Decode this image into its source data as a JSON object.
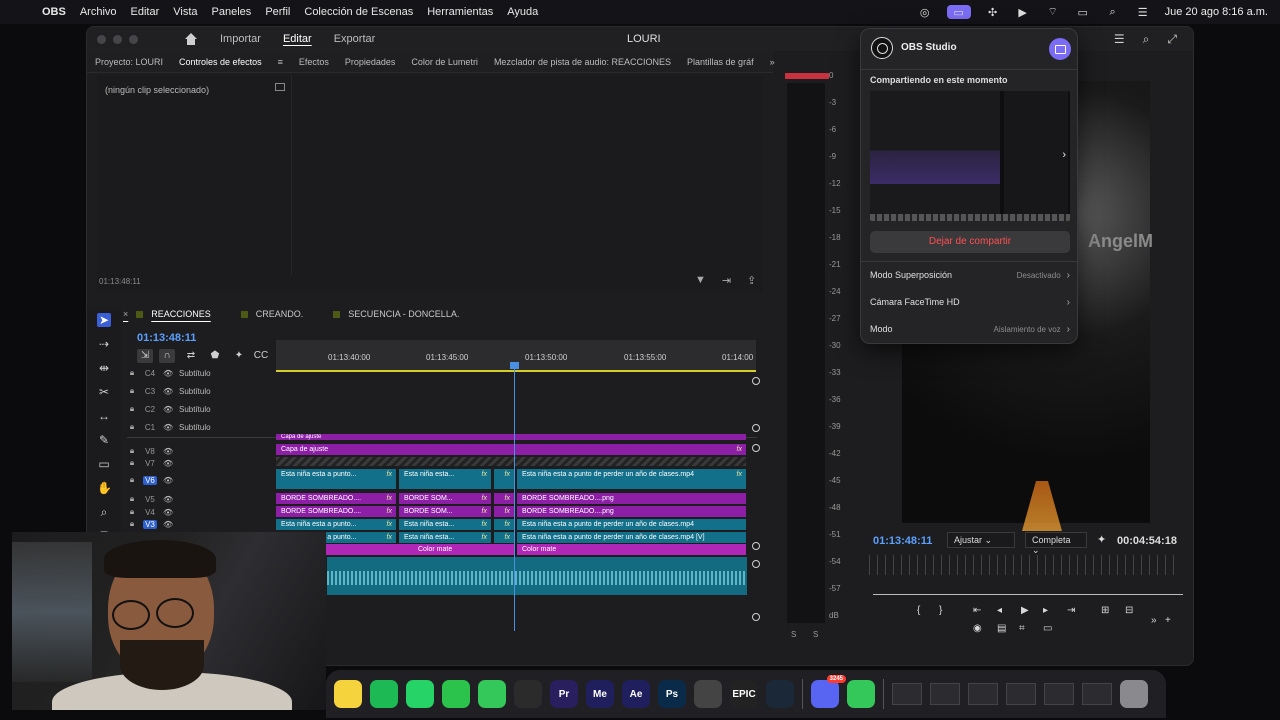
{
  "menubar": {
    "app": "OBS",
    "menus": [
      "Archivo",
      "Editar",
      "Vista",
      "Paneles",
      "Perfil",
      "Colección de Escenas",
      "Herramientas",
      "Ayuda"
    ],
    "clock": "Jue 20 ago 8:16 a.m."
  },
  "premiere": {
    "workspace_tabs": [
      "Importar",
      "Editar",
      "Exportar"
    ],
    "active_workspace": "Editar",
    "project_name": "LOURI",
    "panel_tabs": [
      "Proyecto: LOURI",
      "Controles de efectos",
      "Efectos",
      "Propiedades",
      "Color de Lumetri",
      "Mezclador de pista de audio: REACCIONES",
      "Plantillas de gráf"
    ],
    "effect_controls": {
      "no_clip": "(ningún clip seleccionado)",
      "time": "01:13:48:11"
    },
    "meter_labels": [
      "0",
      "-3",
      "-6",
      "-9",
      "-12",
      "-15",
      "-18",
      "-21",
      "-24",
      "-27",
      "-30",
      "-33",
      "-36",
      "-39",
      "-42",
      "-45",
      "-48",
      "-51",
      "-54",
      "-57",
      "dB"
    ],
    "meter_footer": [
      "S",
      "S"
    ],
    "sequence_tabs": [
      "REACCIONES",
      "CREANDO.",
      "SECUENCIA - DONCELLA."
    ],
    "timeline": {
      "timecode": "01:13:48:11",
      "ruler_labels": [
        "01:13:40:00",
        "01:13:45:00",
        "01:13:50:00",
        "01:13:55:00",
        "01:14:00"
      ],
      "caption_tracks": [
        {
          "name": "C4",
          "label": "Subtítulo"
        },
        {
          "name": "C3",
          "label": "Subtítulo"
        },
        {
          "name": "C2",
          "label": "Subtítulo"
        },
        {
          "name": "C1",
          "label": "Subtítulo"
        }
      ],
      "video_tracks": [
        "V8",
        "V7",
        "V6",
        "V5",
        "V4",
        "V3"
      ],
      "clips": {
        "capa_top": "Capa de ajuste",
        "capa": "Capa de ajuste",
        "v6_a": "Esta niña esta a punto...",
        "v6_b": "Esta niña esta...",
        "v6_c": "Esta niña esta a punto de perder un año de clases.mp4",
        "v5_a": "BORDE SOMBREADO....",
        "v5_b": "BORDE SOM...",
        "v5_c": "BORDE SOMBREADO....png",
        "v4_a": "BORDE SOMBREADO....",
        "v4_b": "BORDE SOM...",
        "v4_c": "BORDE SOMBREADO....png",
        "v3_a": "Esta niña esta a punto...",
        "v3_b": "Esta niña esta...",
        "v3_c": "Esta niña esta a punto de perder un año de clases.mp4",
        "v2_a": "Esta niña esta a punto...",
        "v2_b": "Esta niña esta...",
        "v2_c": "Esta niña esta a punto de perder un año de clases.mp4 [V]",
        "mate_a": "e",
        "mate_b": "Color mate",
        "mate_c": "Color mate"
      },
      "fx": "fx"
    },
    "monitor": {
      "timecode": "01:13:48:11",
      "fit": "Ajustar",
      "quality": "Completa",
      "duration": "00:04:54:18",
      "overlay_text": "AngelM"
    }
  },
  "obs_popover": {
    "title": "OBS Studio",
    "sharing_label": "Compartiendo en este momento",
    "stop_button": "Dejar de compartir",
    "rows": [
      {
        "label": "Modo Superposición",
        "value": "Desactivado"
      },
      {
        "label": "Cámara FaceTime HD",
        "value": ""
      },
      {
        "label": "Modo",
        "value": "Aislamiento de voz"
      }
    ]
  },
  "dock": {
    "icons": [
      {
        "name": "notes",
        "label": "",
        "color": "#f5d33d"
      },
      {
        "name": "spotify",
        "label": "",
        "color": "#1db954"
      },
      {
        "name": "whatsapp",
        "label": "",
        "color": "#25d366"
      },
      {
        "name": "facetime",
        "label": "",
        "color": "#2bc34c"
      },
      {
        "name": "messages",
        "label": "",
        "color": "#34c759"
      },
      {
        "name": "obs",
        "label": "",
        "color": "#2b2b2b"
      },
      {
        "name": "premiere",
        "label": "Pr",
        "color": "#2a1f5e"
      },
      {
        "name": "media-encoder",
        "label": "Me",
        "color": "#1f1f5e"
      },
      {
        "name": "after-effects",
        "label": "Ae",
        "color": "#1f1f5e"
      },
      {
        "name": "photoshop",
        "label": "Ps",
        "color": "#0a2a4a"
      },
      {
        "name": "davinci",
        "label": "",
        "color": "#444"
      },
      {
        "name": "epic-games",
        "label": "EPIC",
        "color": "#222"
      },
      {
        "name": "steam",
        "label": "",
        "color": "#1b2838"
      },
      {
        "name": "discord",
        "label": "",
        "color": "#5865f2",
        "badge": "3245"
      },
      {
        "name": "phone",
        "label": "",
        "color": "#34c759"
      }
    ]
  },
  "colors": {
    "accent": "#7b6cf5",
    "timecode_blue": "#5aa0ff",
    "stop_red": "#ff5050",
    "clip_purple": "#8c1fa6",
    "clip_teal": "#13708a"
  }
}
